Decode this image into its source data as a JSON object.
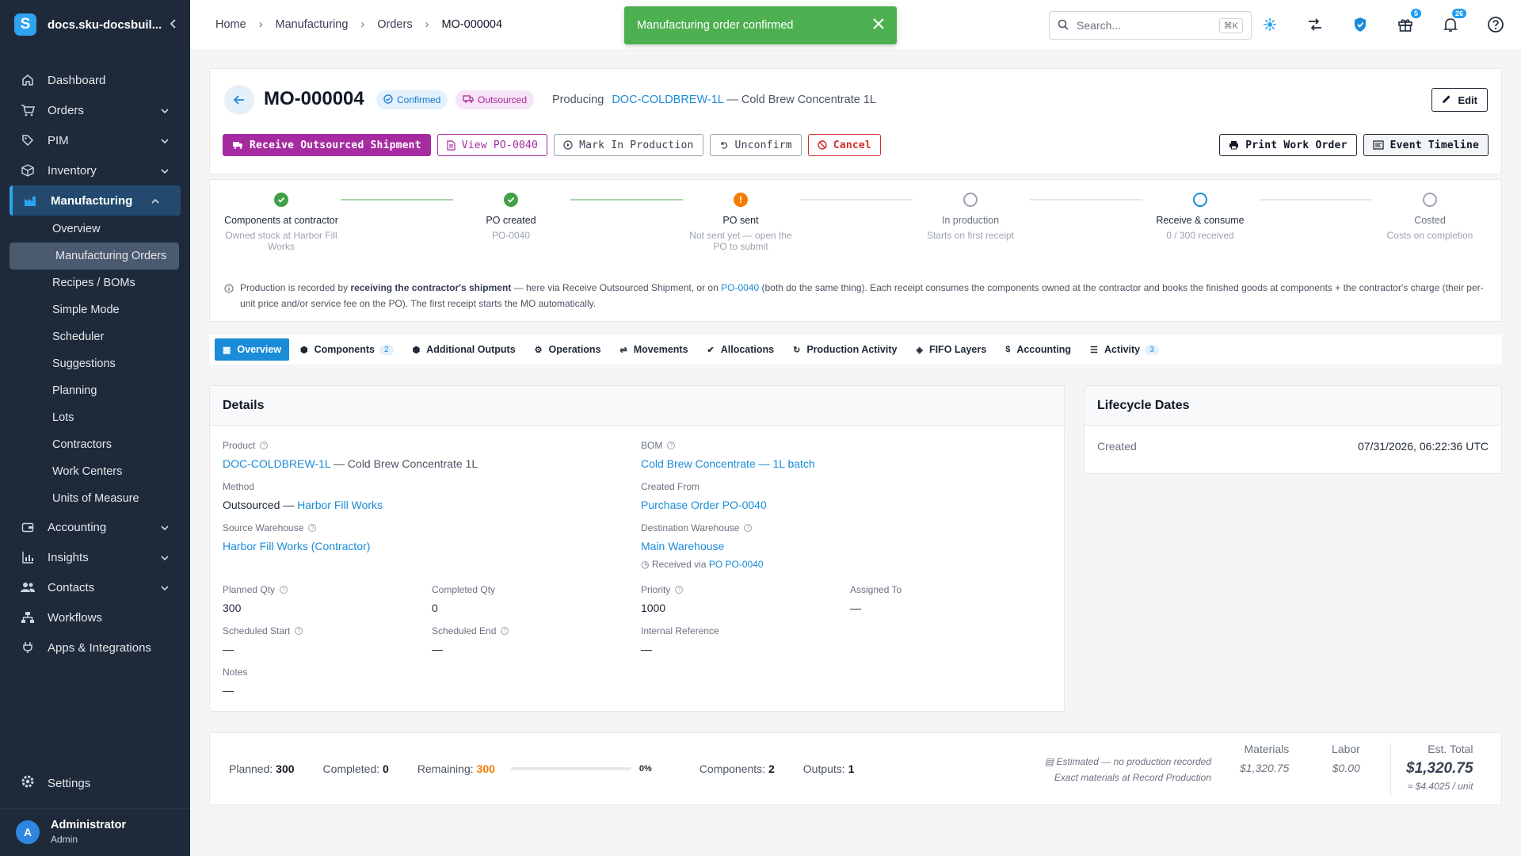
{
  "sidebar": {
    "brand": "docs.sku-docsbuil...",
    "logo_letter": "S",
    "items": [
      {
        "label": "Dashboard",
        "icon": "home-icon"
      },
      {
        "label": "Orders",
        "icon": "cart-icon"
      },
      {
        "label": "PIM",
        "icon": "tag-icon"
      },
      {
        "label": "Inventory",
        "icon": "box-icon"
      },
      {
        "label": "Manufacturing",
        "icon": "factory-icon"
      },
      {
        "label": "Accounting",
        "icon": "wallet-icon"
      },
      {
        "label": "Insights",
        "icon": "chart-icon"
      },
      {
        "label": "Contacts",
        "icon": "contacts-icon"
      },
      {
        "label": "Workflows",
        "icon": "workflow-icon"
      },
      {
        "label": "Apps & Integrations",
        "icon": "plug-icon"
      }
    ],
    "sub_items": [
      "Overview",
      "Manufacturing Orders",
      "Recipes / BOMs",
      "Simple Mode",
      "Scheduler",
      "Suggestions",
      "Planning",
      "Lots",
      "Contractors",
      "Work Centers",
      "Units of Measure"
    ],
    "settings": "Settings",
    "user": {
      "initial": "A",
      "name": "Administrator",
      "role": "Admin"
    }
  },
  "topbar": {
    "breadcrumbs": [
      "Home",
      "Manufacturing",
      "Orders",
      "MO-000004"
    ],
    "search_placeholder": "Search...",
    "search_shortcut": "⌘K",
    "gift_badge": "5",
    "bell_badge": "26"
  },
  "toast": {
    "message": "Manufacturing order confirmed"
  },
  "header": {
    "title": "MO-000004",
    "status_confirmed": "Confirmed",
    "status_outsourced": "Outsourced",
    "producing_label": "Producing",
    "product_code": "DOC-COLDBREW-1L",
    "product_name": "— Cold Brew Concentrate 1L",
    "edit": "Edit",
    "actions": {
      "receive": "Receive Outsourced Shipment",
      "view_po": "View PO-0040",
      "mark_production": "Mark In Production",
      "unconfirm": "Unconfirm",
      "cancel": "Cancel",
      "print": "Print Work Order",
      "timeline": "Event Timeline"
    }
  },
  "stepper": {
    "steps": [
      {
        "title": "Components at contractor",
        "sub": "Owned stock at Harbor Fill Works",
        "state": "done"
      },
      {
        "title": "PO created",
        "sub": "PO-0040",
        "state": "done"
      },
      {
        "title": "PO sent",
        "sub": "Not sent yet — open the PO to submit",
        "state": "warn"
      },
      {
        "title": "In production",
        "sub": "Starts on first receipt",
        "state": "empty"
      },
      {
        "title": "Receive & consume",
        "sub": "0 / 300 received",
        "state": "active"
      },
      {
        "title": "Costed",
        "sub": "Costs on completion",
        "state": "empty"
      }
    ],
    "warn_glyph": "!",
    "info_pre": "Production is recorded by ",
    "info_bold": "receiving the contractor's shipment",
    "info_mid": " — here via Receive Outsourced Shipment, or on ",
    "info_link": "PO-0040",
    "info_post": " (both do the same thing). Each receipt consumes the components owned at the contractor and books the finished goods at components + the contractor's charge (their per-unit price and/or service fee on the PO). The first receipt starts the MO automatically."
  },
  "tabs": [
    {
      "label": "Overview",
      "icon": "grid-icon",
      "count": ""
    },
    {
      "label": "Components",
      "icon": "cube-icon",
      "count": "2"
    },
    {
      "label": "Additional Outputs",
      "icon": "cube-icon",
      "count": ""
    },
    {
      "label": "Operations",
      "icon": "gear-icon",
      "count": ""
    },
    {
      "label": "Movements",
      "icon": "arrows-icon",
      "count": ""
    },
    {
      "label": "Allocations",
      "icon": "check-circle-icon",
      "count": ""
    },
    {
      "label": "Production Activity",
      "icon": "history-icon",
      "count": ""
    },
    {
      "label": "FIFO Layers",
      "icon": "layers-icon",
      "count": ""
    },
    {
      "label": "Accounting",
      "icon": "dollar-icon",
      "count": ""
    },
    {
      "label": "Activity",
      "icon": "list-icon",
      "count": "3"
    }
  ],
  "details": {
    "title": "Details",
    "product_label": "Product",
    "product_code": "DOC-COLDBREW-1L",
    "product_name": " — Cold Brew Concentrate 1L",
    "bom_label": "BOM",
    "bom_value": "Cold Brew Concentrate — 1L batch",
    "method_label": "Method",
    "method_value": "Outsourced — ",
    "method_link": "Harbor Fill Works",
    "created_from_label": "Created From",
    "created_from_value": "Purchase Order PO-0040",
    "source_wh_label": "Source Warehouse",
    "source_wh_value": "Harbor Fill Works (Contractor)",
    "dest_wh_label": "Destination Warehouse",
    "dest_wh_value": "Main Warehouse",
    "received_via": "Received via ",
    "received_via_link": "PO PO-0040",
    "planned_qty_label": "Planned Qty",
    "planned_qty": "300",
    "completed_qty_label": "Completed Qty",
    "completed_qty": "0",
    "priority_label": "Priority",
    "priority": "1000",
    "assigned_label": "Assigned To",
    "assigned": "—",
    "sched_start_label": "Scheduled Start",
    "sched_start": "—",
    "sched_end_label": "Scheduled End",
    "sched_end": "—",
    "internal_ref_label": "Internal Reference",
    "internal_ref": "—",
    "notes_label": "Notes",
    "notes": "—"
  },
  "lifecycle": {
    "title": "Lifecycle Dates",
    "created_label": "Created",
    "created_value": "07/31/2026, 06:22:36 UTC"
  },
  "summary": {
    "planned_label": "Planned:",
    "planned": "300",
    "completed_label": "Completed:",
    "completed": "0",
    "remaining_label": "Remaining:",
    "remaining": "300",
    "progress_fraction": 0,
    "progress_pct": "0%",
    "components_label": "Components:",
    "components": "2",
    "outputs_label": "Outputs:",
    "outputs": "1",
    "est_line1": "Estimated — no production recorded",
    "est_line2": "Exact materials at Record Production",
    "materials_label": "Materials",
    "materials": "$1,320.75",
    "labor_label": "Labor",
    "labor": "$0.00",
    "total_label": "Est. Total",
    "total": "$1,320.75",
    "per_unit": "≈ $4.4025 / unit"
  },
  "colors": {
    "accent": "#1a8cd8",
    "purple": "#a62ba0",
    "success": "#4caf50",
    "warning": "#f57c00",
    "sidebar": "#1e2a3a"
  }
}
